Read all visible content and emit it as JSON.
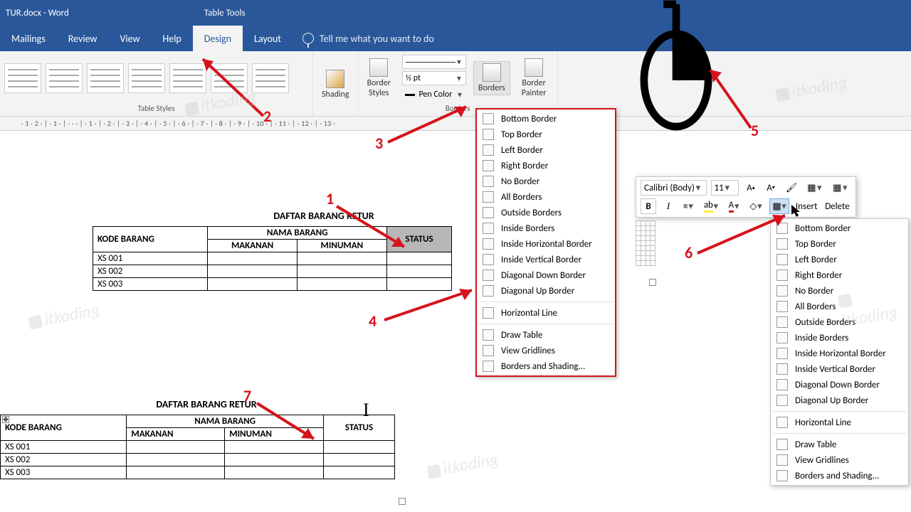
{
  "title_bar": {
    "filename": "TUR.docx  -  Word",
    "contextual": "Table Tools"
  },
  "tabs": [
    "Mailings",
    "Review",
    "View",
    "Help",
    "Design",
    "Layout"
  ],
  "active_tab": "Design",
  "tell_me": "Tell me what you want to do",
  "ribbon": {
    "table_styles_label": "Table Styles",
    "shading": "Shading",
    "border_styles": "Border\nStyles",
    "line_weight": "½ pt",
    "pen_color": "Pen Color",
    "borders": "Borders",
    "border_painter": "Border\nPainter",
    "borders_group_label": "Borders"
  },
  "ruler": "· 1 · 2 · | · 1 · | · · · | · 1 · | · 2 · | · 3 · | · 4 · | · 5 · | · 6 · | · 7 · | · 8 · | · 9 · | · 10 · | · 11 · | · 12 · | · 13 ·",
  "document": {
    "title": "DAFTAR BARANG RETUR",
    "headers": {
      "kode": "KODE BARANG",
      "nama": "NAMA BARANG",
      "makanan": "MAKANAN",
      "minuman": "MINUMAN",
      "status": "STATUS"
    },
    "rows": [
      "XS 001",
      "XS 002",
      "XS 003"
    ]
  },
  "borders_menu": [
    "Bottom Border",
    "Top Border",
    "Left Border",
    "Right Border",
    "No Border",
    "All Borders",
    "Outside Borders",
    "Inside Borders",
    "Inside Horizontal Border",
    "Inside Vertical Border",
    "Diagonal Down Border",
    "Diagonal Up Border",
    "—",
    "Horizontal Line",
    "—",
    "Draw Table",
    "View Gridlines",
    "Borders and Shading..."
  ],
  "mini_toolbar": {
    "font": "Calibri (Body)",
    "size": "11",
    "insert": "Insert",
    "delete": "Delete",
    "bold": "B",
    "italic": "I"
  },
  "annotations": {
    "1": "1",
    "2": "2",
    "3": "3",
    "4": "4",
    "5": "5",
    "6": "6",
    "7": "7"
  },
  "watermark": "itkoding"
}
